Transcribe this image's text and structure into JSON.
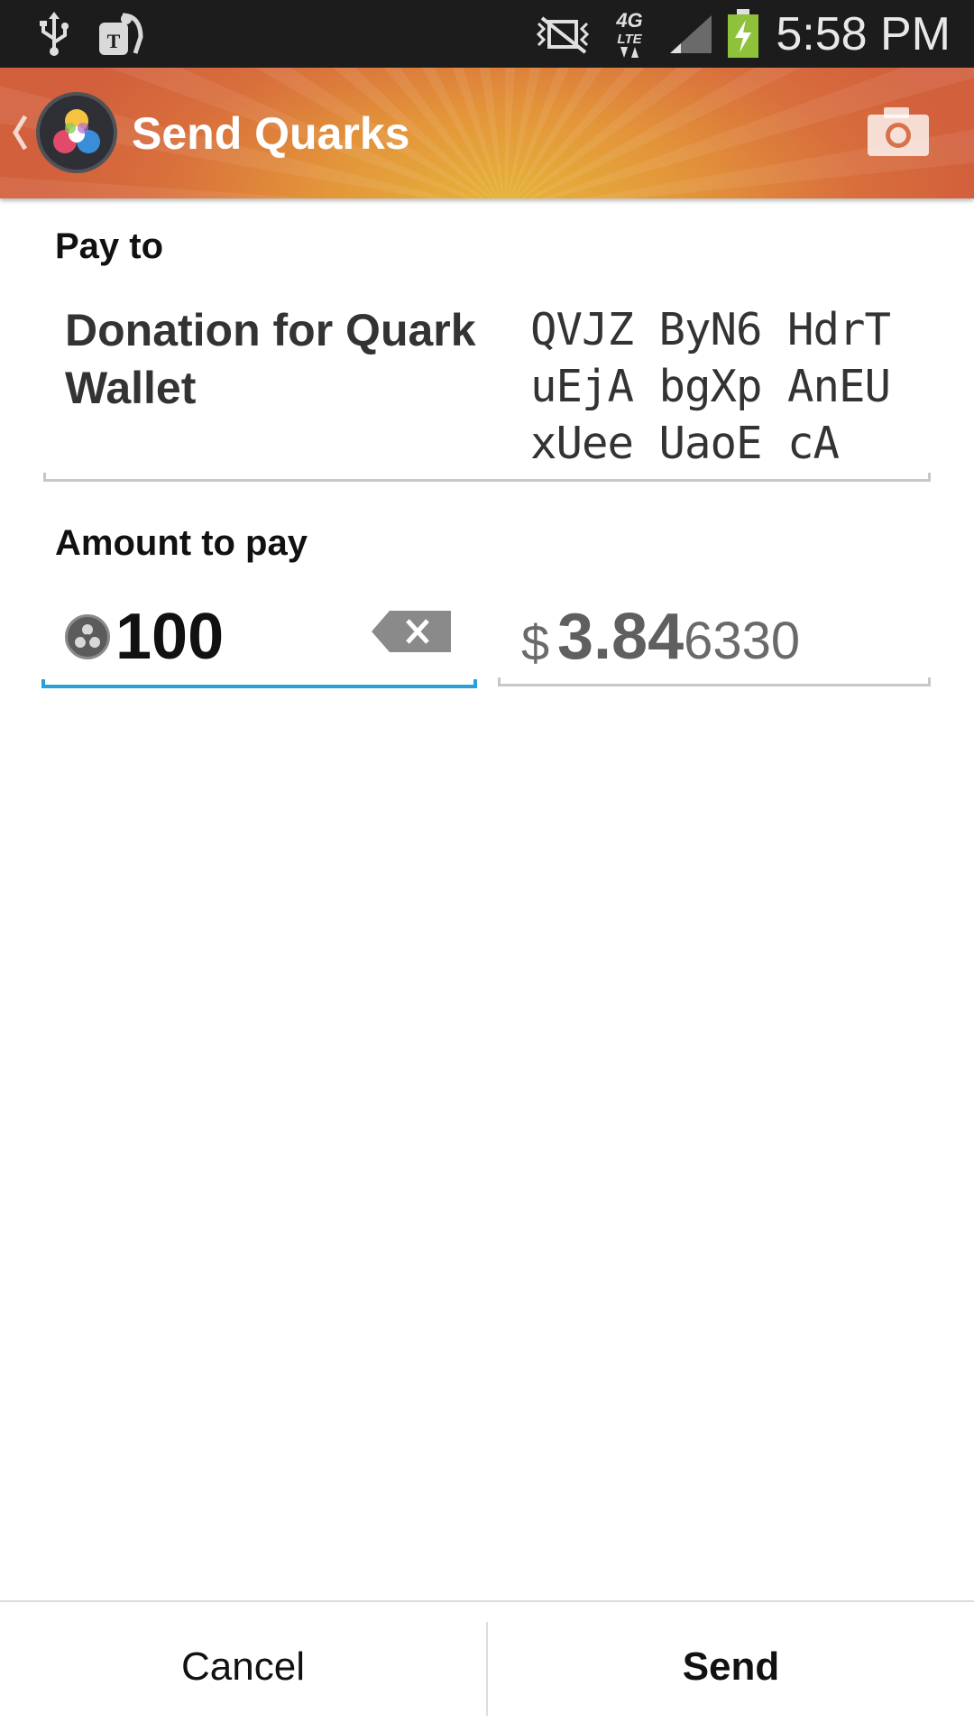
{
  "status_bar": {
    "time": "5:58 PM",
    "icons": [
      "usb-icon",
      "tmobile-icon",
      "silent-mode-icon",
      "network-4g-lte-icon",
      "signal-icon",
      "battery-charging-icon"
    ]
  },
  "action_bar": {
    "title": "Send Quarks",
    "icons": [
      "back-chevron-icon",
      "app-logo-icon",
      "camera-icon"
    ]
  },
  "pay_to": {
    "label": "Pay to",
    "name": "Donation for Quark Wallet",
    "address": "QVJZ ByN6 HdrT\nuEjA bgXp AnEU\nxUee UaoE cA"
  },
  "amount": {
    "label": "Amount to pay",
    "value": "100",
    "currency_icon": "quark-coin-icon",
    "clear_icon": "backspace-icon"
  },
  "fiat": {
    "symbol": "$",
    "main": "3.84",
    "rest": "6330"
  },
  "buttons": {
    "cancel": "Cancel",
    "send": "Send"
  },
  "colors": {
    "accent": "#2aa1d6",
    "action_bar": "#e3943a",
    "status_bar": "#1c1c1c"
  }
}
